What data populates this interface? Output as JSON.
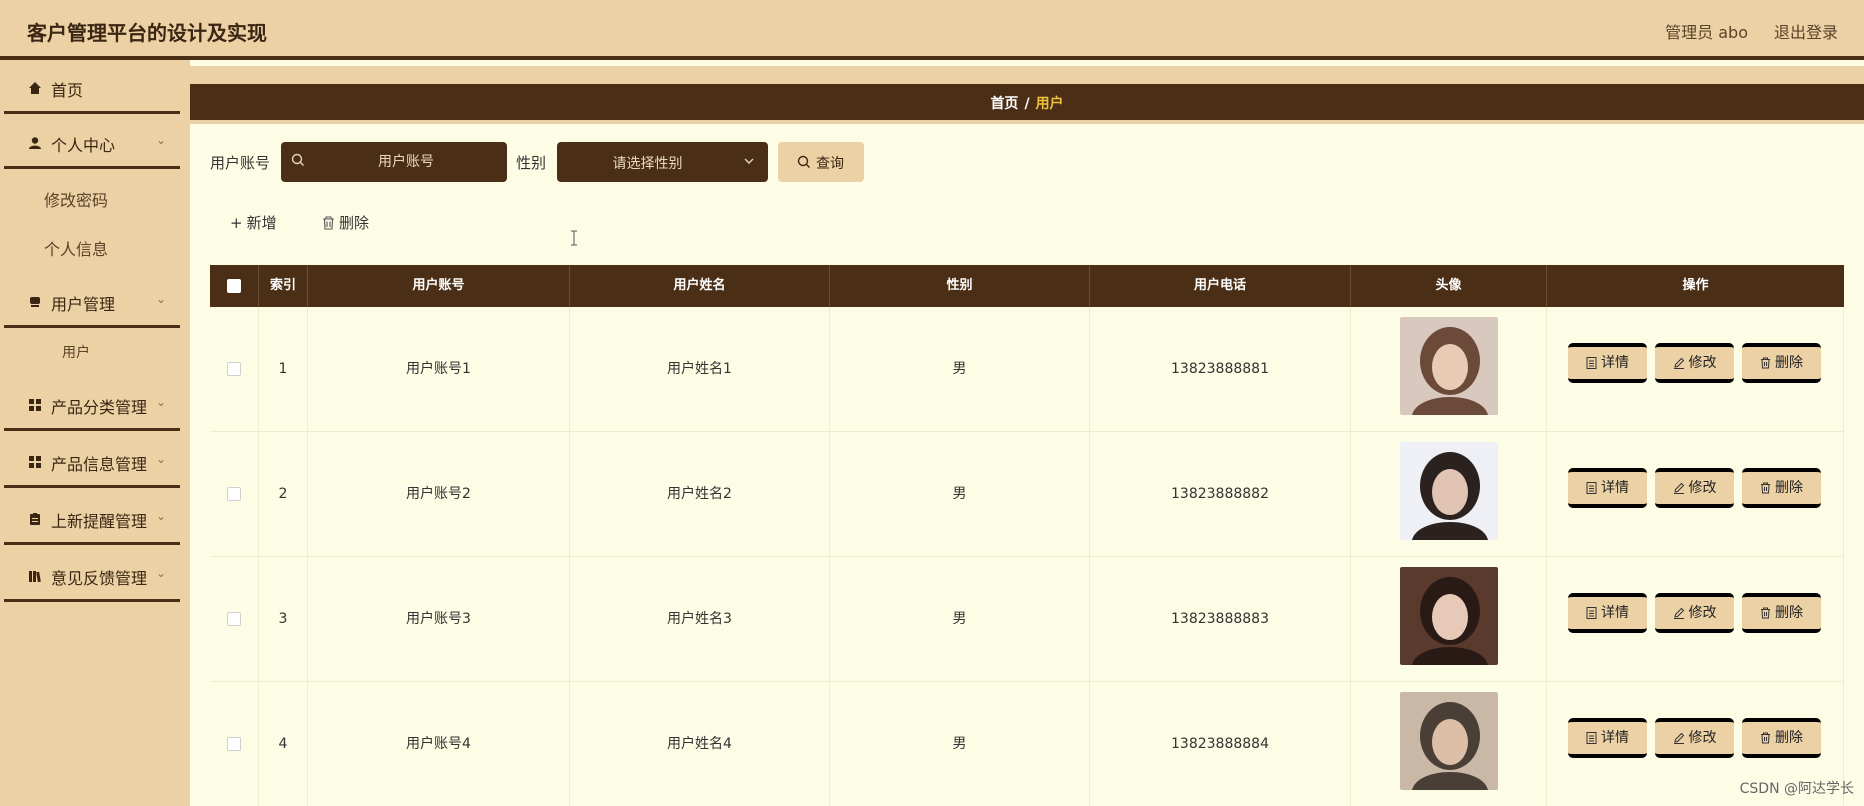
{
  "app": {
    "title": "客户管理平台的设计及实现"
  },
  "header": {
    "user_label": "管理员 abo",
    "logout_label": "退出登录"
  },
  "sidebar": {
    "items": [
      {
        "label": "首页",
        "icon": "home-icon"
      },
      {
        "label": "个人中心",
        "icon": "person-icon",
        "expanded": true,
        "children": [
          "修改密码",
          "个人信息"
        ]
      },
      {
        "label": "用户管理",
        "icon": "users-icon",
        "expanded": true,
        "children": [
          "用户"
        ]
      },
      {
        "label": "产品分类管理",
        "icon": "grid-icon"
      },
      {
        "label": "产品信息管理",
        "icon": "grid-icon"
      },
      {
        "label": "上新提醒管理",
        "icon": "clipboard-icon"
      },
      {
        "label": "意见反馈管理",
        "icon": "books-icon"
      }
    ]
  },
  "breadcrumb": {
    "home": "首页",
    "separator": "/",
    "current": "用户"
  },
  "filters": {
    "account_label": "用户账号",
    "account_placeholder": "用户账号",
    "gender_label": "性别",
    "gender_placeholder": "请选择性别",
    "query_label": "查询"
  },
  "actions": {
    "add_label": "新增",
    "delete_label": "删除"
  },
  "table": {
    "columns": [
      "索引",
      "用户账号",
      "用户姓名",
      "性别",
      "用户电话",
      "头像",
      "操作"
    ],
    "rows": [
      {
        "index": "1",
        "account": "用户账号1",
        "name": "用户姓名1",
        "gender": "男",
        "phone": "13823888881"
      },
      {
        "index": "2",
        "account": "用户账号2",
        "name": "用户姓名2",
        "gender": "男",
        "phone": "13823888882"
      },
      {
        "index": "3",
        "account": "用户账号3",
        "name": "用户姓名3",
        "gender": "男",
        "phone": "13823888883"
      },
      {
        "index": "4",
        "account": "用户账号4",
        "name": "用户姓名4",
        "gender": "男",
        "phone": "13823888884"
      }
    ],
    "row_actions": {
      "detail": "详情",
      "edit": "修改",
      "delete": "删除"
    }
  },
  "watermark": "CSDN @阿达学长",
  "colors": {
    "header_bg": "#ecd1a5",
    "dark_brown": "#4a2e15",
    "content_bg": "#fdfde5",
    "crumb_active": "#f0c040"
  }
}
